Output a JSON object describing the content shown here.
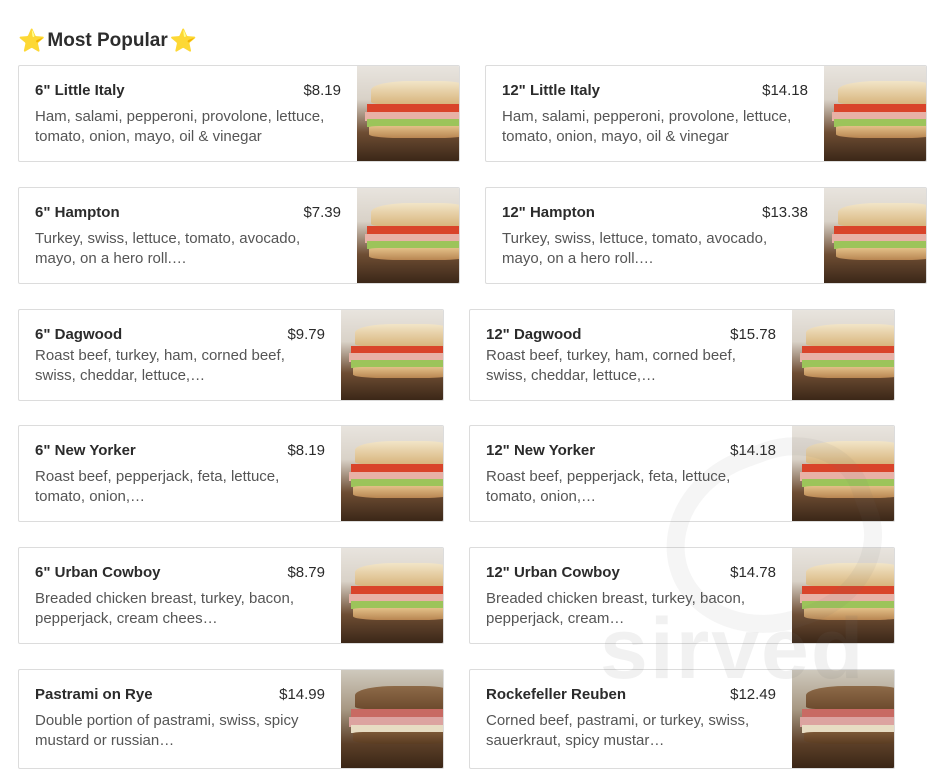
{
  "section": {
    "title": "Most Popular",
    "star_left": "⭐",
    "star_right": "⭐"
  },
  "items": [
    {
      "name": "6\" Little Italy",
      "price": "$8.19",
      "desc": "Ham, salami, pepperoni, provolone, lettuce, tomato, onion, mayo, oil & vinegar"
    },
    {
      "name": "12\" Little Italy",
      "price": "$14.18",
      "desc": "Ham, salami, pepperoni, provolone, lettuce, tomato, onion, mayo, oil & vinegar"
    },
    {
      "name": "6\" Hampton",
      "price": "$7.39",
      "desc": "Turkey, swiss, lettuce, tomato, avocado, mayo, on a hero roll.…"
    },
    {
      "name": "12\" Hampton",
      "price": "$13.38",
      "desc": "Turkey, swiss, lettuce, tomato, avocado, mayo, on a hero roll.…"
    },
    {
      "name": "6\" Dagwood",
      "price": "$9.79",
      "desc": "Roast beef, turkey, ham, corned beef, swiss, cheddar, lettuce,…"
    },
    {
      "name": "12\" Dagwood",
      "price": "$15.78",
      "desc": "Roast beef, turkey, ham, corned beef, swiss, cheddar, lettuce,…"
    },
    {
      "name": "6\" New Yorker",
      "price": "$8.19",
      "desc": "Roast beef, pepperjack, feta, lettuce, tomato, onion,…"
    },
    {
      "name": "12\" New Yorker",
      "price": "$14.18",
      "desc": "Roast beef, pepperjack, feta, lettuce, tomato, onion,…"
    },
    {
      "name": "6\" Urban Cowboy",
      "price": "$8.79",
      "desc": "Breaded chicken breast, turkey, bacon, pepperjack, cream chees…"
    },
    {
      "name": "12\" Urban Cowboy",
      "price": "$14.78",
      "desc": "Breaded chicken breast, turkey, bacon, pepperjack, cream…"
    },
    {
      "name": "Pastrami on Rye",
      "price": "$14.99",
      "desc": "Double portion of pastrami, swiss, spicy mustard or russian…"
    },
    {
      "name": "Rockefeller Reuben",
      "price": "$12.49",
      "desc": "Corned beef, pastrami, or turkey, swiss, sauerkraut, spicy mustar…"
    }
  ],
  "watermark": "sirved"
}
